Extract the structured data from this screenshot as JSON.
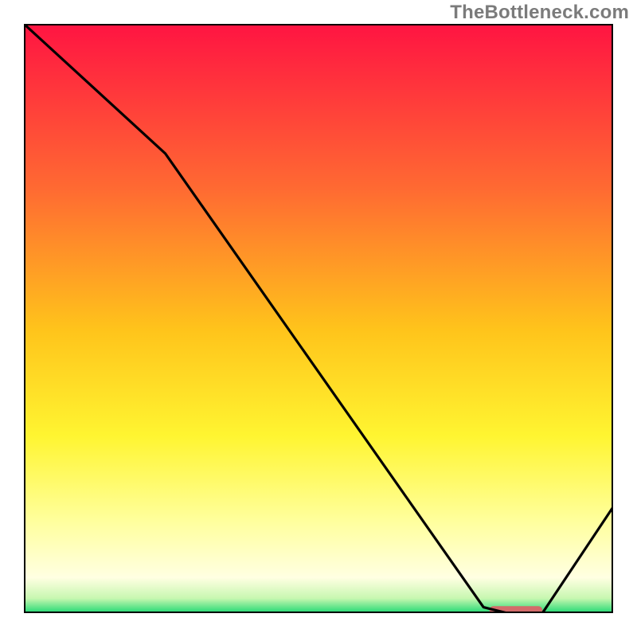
{
  "watermark": "TheBottleneck.com",
  "chart_data": {
    "type": "line",
    "title": "",
    "xlabel": "",
    "ylabel": "",
    "xlim": [
      0,
      100
    ],
    "ylim": [
      0,
      100
    ],
    "series": [
      {
        "name": "curve",
        "x": [
          0,
          24,
          78,
          82,
          88,
          100
        ],
        "values": [
          100,
          78,
          1,
          0,
          0,
          18
        ]
      }
    ],
    "marker": {
      "name": "highlight",
      "x_start": 79,
      "x_end": 88,
      "y": 0.5,
      "color": "#d36b6a"
    },
    "gradient_stops": [
      {
        "pos": 0.0,
        "color": "#ff1442"
      },
      {
        "pos": 0.28,
        "color": "#ff6a32"
      },
      {
        "pos": 0.52,
        "color": "#ffc41b"
      },
      {
        "pos": 0.7,
        "color": "#fff531"
      },
      {
        "pos": 0.84,
        "color": "#ffff9a"
      },
      {
        "pos": 0.94,
        "color": "#ffffe2"
      },
      {
        "pos": 0.975,
        "color": "#c7f7b0"
      },
      {
        "pos": 1.0,
        "color": "#1fd873"
      }
    ],
    "grid": false,
    "legend": false
  }
}
